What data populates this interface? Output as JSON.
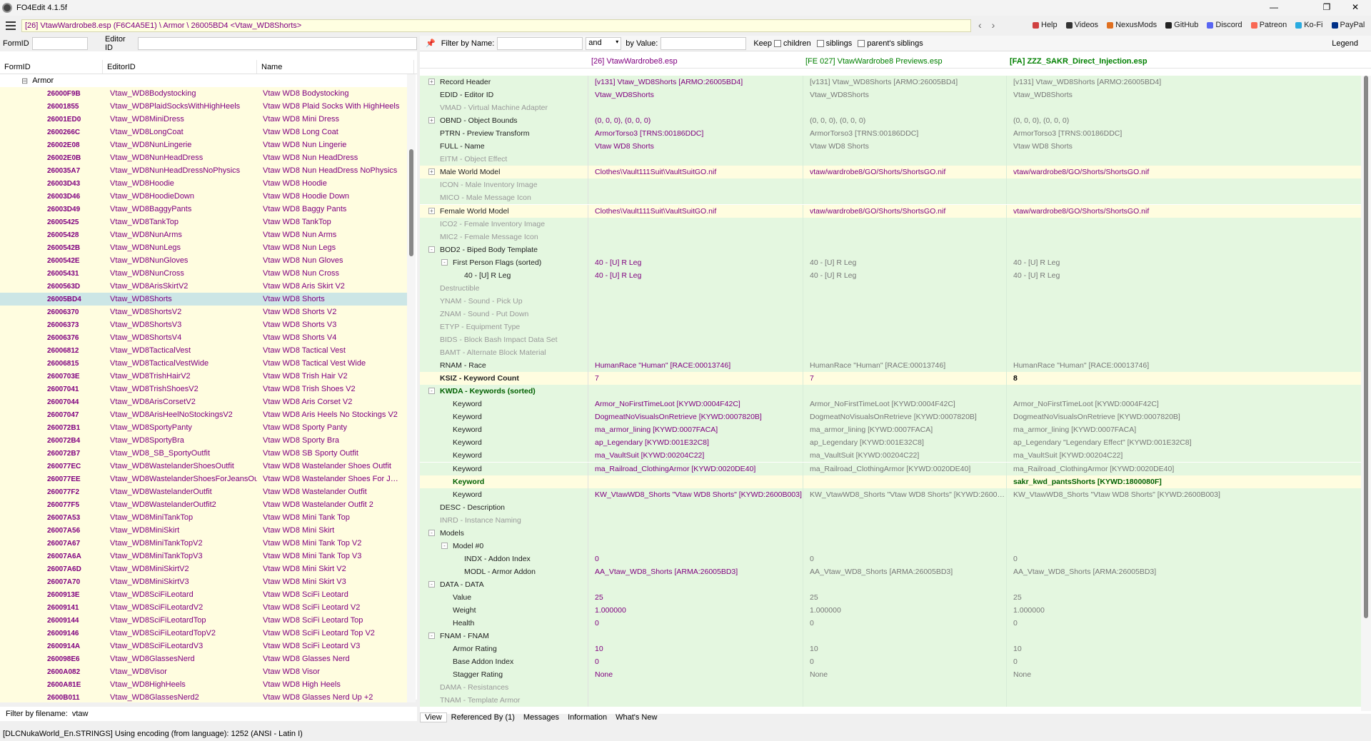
{
  "window": {
    "title": "FO4Edit 4.1.5f"
  },
  "toolbar": {
    "path": "[26] VtawWardrobe8.esp (F6C4A5E1) \\ Armor \\ 26005BD4 <Vtaw_WD8Shorts>",
    "links": [
      {
        "label": "Help",
        "color": "#d04040"
      },
      {
        "label": "Videos",
        "color": "#333"
      },
      {
        "label": "NexusMods",
        "color": "#e07020"
      },
      {
        "label": "GitHub",
        "color": "#222"
      },
      {
        "label": "Discord",
        "color": "#5865f2"
      },
      {
        "label": "Patreon",
        "color": "#f96854"
      },
      {
        "label": "Ko-Fi",
        "color": "#29abe0"
      },
      {
        "label": "PayPal",
        "color": "#003087"
      }
    ]
  },
  "left": {
    "formid_label": "FormID",
    "editorid_label": "Editor ID",
    "columns": [
      "FormID",
      "EditorID",
      "Name"
    ],
    "group": "Armor",
    "rows": [
      [
        "26000F9B",
        "Vtaw_WD8Bodystocking",
        "Vtaw WD8 Bodystocking"
      ],
      [
        "26001855",
        "Vtaw_WD8PlaidSocksWithHighHeels",
        "Vtaw WD8 Plaid Socks With HighHeels"
      ],
      [
        "26001ED0",
        "Vtaw_WD8MiniDress",
        "Vtaw WD8 Mini Dress"
      ],
      [
        "2600266C",
        "Vtaw_WD8LongCoat",
        "Vtaw WD8 Long Coat"
      ],
      [
        "26002E08",
        "Vtaw_WD8NunLingerie",
        "Vtaw WD8 Nun Lingerie"
      ],
      [
        "26002E0B",
        "Vtaw_WD8NunHeadDress",
        "Vtaw WD8 Nun HeadDress"
      ],
      [
        "260035A7",
        "Vtaw_WD8NunHeadDressNoPhysics",
        "Vtaw WD8 Nun HeadDress NoPhysics"
      ],
      [
        "26003D43",
        "Vtaw_WD8Hoodie",
        "Vtaw WD8 Hoodie"
      ],
      [
        "26003D46",
        "Vtaw_WD8HoodieDown",
        "Vtaw WD8 Hoodie Down"
      ],
      [
        "26003D49",
        "Vtaw_WD8BaggyPants",
        "Vtaw WD8 Baggy Pants"
      ],
      [
        "26005425",
        "Vtaw_WD8TankTop",
        "Vtaw WD8 TankTop"
      ],
      [
        "26005428",
        "Vtaw_WD8NunArms",
        "Vtaw WD8 Nun Arms"
      ],
      [
        "2600542B",
        "Vtaw_WD8NunLegs",
        "Vtaw WD8 Nun Legs"
      ],
      [
        "2600542E",
        "Vtaw_WD8NunGloves",
        "Vtaw WD8 Nun Gloves"
      ],
      [
        "26005431",
        "Vtaw_WD8NunCross",
        "Vtaw WD8 Nun Cross"
      ],
      [
        "2600563D",
        "Vtaw_WD8ArisSkirtV2",
        "Vtaw WD8 Aris Skirt V2"
      ],
      [
        "26005BD4",
        "Vtaw_WD8Shorts",
        "Vtaw WD8 Shorts"
      ],
      [
        "26006370",
        "Vtaw_WD8ShortsV2",
        "Vtaw WD8 Shorts V2"
      ],
      [
        "26006373",
        "Vtaw_WD8ShortsV3",
        "Vtaw WD8 Shorts V3"
      ],
      [
        "26006376",
        "Vtaw_WD8ShortsV4",
        "Vtaw WD8 Shorts V4"
      ],
      [
        "26006812",
        "Vtaw_WD8TacticalVest",
        "Vtaw WD8 Tactical Vest"
      ],
      [
        "26006815",
        "Vtaw_WD8TacticalVestWide",
        "Vtaw WD8 Tactical Vest Wide"
      ],
      [
        "2600703E",
        "Vtaw_WD8TrishHairV2",
        "Vtaw WD8 Trish Hair V2"
      ],
      [
        "26007041",
        "Vtaw_WD8TrishShoesV2",
        "Vtaw WD8 Trish Shoes V2"
      ],
      [
        "26007044",
        "Vtaw_WD8ArisCorsetV2",
        "Vtaw WD8 Aris Corset V2"
      ],
      [
        "26007047",
        "Vtaw_WD8ArisHeelNoStockingsV2",
        "Vtaw WD8 Aris Heels No Stockings V2"
      ],
      [
        "260072B1",
        "Vtaw_WD8SportyPanty",
        "Vtaw WD8 Sporty Panty"
      ],
      [
        "260072B4",
        "Vtaw_WD8SportyBra",
        "Vtaw WD8 Sporty Bra"
      ],
      [
        "260072B7",
        "Vtaw_WD8_SB_SportyOutfit",
        "Vtaw WD8 SB Sporty Outfit"
      ],
      [
        "260077EC",
        "Vtaw_WD8WastelanderShoesOutfit",
        "Vtaw WD8 Wastelander Shoes Outfit"
      ],
      [
        "260077EE",
        "Vtaw_WD8WastelanderShoesForJeansOu...",
        "Vtaw WD8 Wastelander Shoes For Jeans..."
      ],
      [
        "260077F2",
        "Vtaw_WD8WastelanderOutfit",
        "Vtaw WD8 Wastelander Outfit"
      ],
      [
        "260077F5",
        "Vtaw_WD8WastelanderOutfit2",
        "Vtaw WD8 Wastelander Outfit 2"
      ],
      [
        "26007A53",
        "Vtaw_WD8MiniTankTop",
        "Vtaw WD8 Mini Tank Top"
      ],
      [
        "26007A56",
        "Vtaw_WD8MiniSkirt",
        "Vtaw WD8 Mini Skirt"
      ],
      [
        "26007A67",
        "Vtaw_WD8MiniTankTopV2",
        "Vtaw WD8 Mini Tank Top V2"
      ],
      [
        "26007A6A",
        "Vtaw_WD8MiniTankTopV3",
        "Vtaw WD8 Mini Tank Top V3"
      ],
      [
        "26007A6D",
        "Vtaw_WD8MiniSkirtV2",
        "Vtaw WD8 Mini Skirt V2"
      ],
      [
        "26007A70",
        "Vtaw_WD8MiniSkirtV3",
        "Vtaw WD8 Mini Skirt V3"
      ],
      [
        "2600913E",
        "Vtaw_WD8SciFiLeotard",
        "Vtaw WD8 SciFi Leotard"
      ],
      [
        "26009141",
        "Vtaw_WD8SciFiLeotardV2",
        "Vtaw WD8 SciFi Leotard V2"
      ],
      [
        "26009144",
        "Vtaw_WD8SciFiLeotardTop",
        "Vtaw WD8 SciFi Leotard Top"
      ],
      [
        "26009146",
        "Vtaw_WD8SciFiLeotardTopV2",
        "Vtaw WD8 SciFi Leotard Top V2"
      ],
      [
        "2600914A",
        "Vtaw_WD8SciFiLeotardV3",
        "Vtaw WD8 SciFi Leotard V3"
      ],
      [
        "260098E6",
        "Vtaw_WD8GlassesNerd",
        "Vtaw WD8 Glasses Nerd"
      ],
      [
        "2600A082",
        "Vtaw_WD8Visor",
        "Vtaw WD8 Visor"
      ],
      [
        "2600A81E",
        "Vtaw_WD8HighHeels",
        "Vtaw WD8 High Heels"
      ],
      [
        "2600B011",
        "Vtaw_WD8GlassesNerd2",
        "Vtaw WD8 Glasses Nerd  Up +2"
      ]
    ],
    "selected_index": 16,
    "filename_filter_label": "Filter by filename:",
    "filename_filter_value": "vtaw"
  },
  "right": {
    "filter": {
      "name_label": "Filter by Name:",
      "op": "and",
      "value_label": "by Value:",
      "keep": "Keep",
      "children": "children",
      "siblings": "siblings",
      "parents": "parent's siblings",
      "legend": "Legend"
    },
    "files": [
      "[26] VtawWardrobe8.esp",
      "[FE 027] VtawWardrobe8 Previews.esp",
      "[FA] ZZZ_SAKR_Direct_Injection.esp"
    ],
    "rows": [
      {
        "l": "Record Header",
        "i": 0,
        "e": "+",
        "v": [
          "[v131] Vtaw_WD8Shorts [ARMO:26005BD4]",
          "[v131] Vtaw_WD8Shorts [ARMO:26005BD4]",
          "[v131] Vtaw_WD8Shorts [ARMO:26005BD4]"
        ],
        "bg": "g"
      },
      {
        "l": "EDID - Editor ID",
        "i": 0,
        "v": [
          "Vtaw_WD8Shorts",
          "Vtaw_WD8Shorts",
          "Vtaw_WD8Shorts"
        ],
        "bg": "g"
      },
      {
        "l": "VMAD - Virtual Machine Adapter",
        "i": 0,
        "v": [
          "",
          "",
          ""
        ],
        "bg": "g",
        "dim": true
      },
      {
        "l": "OBND - Object Bounds",
        "i": 0,
        "e": "+",
        "v": [
          "(0, 0, 0), (0, 0, 0)",
          "(0, 0, 0), (0, 0, 0)",
          "(0, 0, 0), (0, 0, 0)"
        ],
        "bg": "g"
      },
      {
        "l": "PTRN - Preview Transform",
        "i": 0,
        "v": [
          "ArmorTorso3 [TRNS:00186DDC]",
          "ArmorTorso3 [TRNS:00186DDC]",
          "ArmorTorso3 [TRNS:00186DDC]"
        ],
        "bg": "g"
      },
      {
        "l": "FULL - Name",
        "i": 0,
        "v": [
          "Vtaw WD8 Shorts",
          "Vtaw WD8 Shorts",
          "Vtaw WD8 Shorts"
        ],
        "bg": "g"
      },
      {
        "l": "EITM - Object Effect",
        "i": 0,
        "v": [
          "",
          "",
          ""
        ],
        "bg": "g",
        "dim": true
      },
      {
        "l": "Male World Model",
        "i": 0,
        "e": "+",
        "v": [
          "Clothes\\Vault111Suit\\VaultSuitGO.nif",
          "vtaw/wardrobe8/GO/Shorts/ShortsGO.nif",
          "vtaw/wardrobe8/GO/Shorts/ShortsGO.nif"
        ],
        "bg": "y"
      },
      {
        "l": "ICON - Male Inventory Image",
        "i": 0,
        "v": [
          "",
          "",
          ""
        ],
        "bg": "g",
        "dim": true
      },
      {
        "l": "MICO - Male Message Icon",
        "i": 0,
        "v": [
          "",
          "",
          ""
        ],
        "bg": "g",
        "dim": true
      },
      {
        "l": "Female World Model",
        "i": 0,
        "e": "+",
        "v": [
          "Clothes\\Vault111Suit\\VaultSuitGO.nif",
          "vtaw/wardrobe8/GO/Shorts/ShortsGO.nif",
          "vtaw/wardrobe8/GO/Shorts/ShortsGO.nif"
        ],
        "bg": "y"
      },
      {
        "l": "ICO2 - Female Inventory Image",
        "i": 0,
        "v": [
          "",
          "",
          ""
        ],
        "bg": "g",
        "dim": true
      },
      {
        "l": "MIC2 - Female Message Icon",
        "i": 0,
        "v": [
          "",
          "",
          ""
        ],
        "bg": "g",
        "dim": true
      },
      {
        "l": "BOD2 - Biped Body Template",
        "i": 0,
        "e": "-",
        "v": [
          "",
          "",
          ""
        ],
        "bg": "g"
      },
      {
        "l": "First Person Flags (sorted)",
        "i": 1,
        "e": "-",
        "v": [
          "40 - [U] R Leg",
          "40 - [U] R Leg",
          "40 - [U] R Leg"
        ],
        "bg": "g"
      },
      {
        "l": "40 - [U] R Leg",
        "i": 2,
        "v": [
          "40 - [U] R Leg",
          "40 - [U] R Leg",
          "40 - [U] R Leg"
        ],
        "bg": "g"
      },
      {
        "l": "Destructible",
        "i": 0,
        "v": [
          "",
          "",
          ""
        ],
        "bg": "g",
        "dim": true
      },
      {
        "l": "YNAM - Sound - Pick Up",
        "i": 0,
        "v": [
          "",
          "",
          ""
        ],
        "bg": "g",
        "dim": true
      },
      {
        "l": "ZNAM - Sound - Put Down",
        "i": 0,
        "v": [
          "",
          "",
          ""
        ],
        "bg": "g",
        "dim": true
      },
      {
        "l": "ETYP - Equipment Type",
        "i": 0,
        "v": [
          "",
          "",
          ""
        ],
        "bg": "g",
        "dim": true
      },
      {
        "l": "BIDS - Block Bash Impact Data Set",
        "i": 0,
        "v": [
          "",
          "",
          ""
        ],
        "bg": "g",
        "dim": true
      },
      {
        "l": "BAMT - Alternate Block Material",
        "i": 0,
        "v": [
          "",
          "",
          ""
        ],
        "bg": "g",
        "dim": true
      },
      {
        "l": "RNAM - Race",
        "i": 0,
        "v": [
          "HumanRace \"Human\" [RACE:00013746]",
          "HumanRace \"Human\" [RACE:00013746]",
          "HumanRace \"Human\" [RACE:00013746]"
        ],
        "bg": "g"
      },
      {
        "l": "KSIZ - Keyword Count",
        "i": 0,
        "v": [
          "7",
          "7",
          "8"
        ],
        "bg": "y",
        "bold": true
      },
      {
        "l": "KWDA - Keywords (sorted)",
        "i": 0,
        "e": "-",
        "v": [
          "",
          "",
          ""
        ],
        "bg": "g",
        "green": true
      },
      {
        "l": "Keyword",
        "i": 1,
        "v": [
          "Armor_NoFirstTimeLoot [KYWD:0004F42C]",
          "Armor_NoFirstTimeLoot [KYWD:0004F42C]",
          "Armor_NoFirstTimeLoot [KYWD:0004F42C]"
        ],
        "bg": "g"
      },
      {
        "l": "Keyword",
        "i": 1,
        "v": [
          "DogmeatNoVisualsOnRetrieve [KYWD:0007820B]",
          "DogmeatNoVisualsOnRetrieve [KYWD:0007820B]",
          "DogmeatNoVisualsOnRetrieve [KYWD:0007820B]"
        ],
        "bg": "g"
      },
      {
        "l": "Keyword",
        "i": 1,
        "v": [
          "ma_armor_lining [KYWD:0007FACA]",
          "ma_armor_lining [KYWD:0007FACA]",
          "ma_armor_lining [KYWD:0007FACA]"
        ],
        "bg": "g"
      },
      {
        "l": "Keyword",
        "i": 1,
        "v": [
          "ap_Legendary [KYWD:001E32C8]",
          "ap_Legendary [KYWD:001E32C8]",
          "ap_Legendary \"Legendary Effect\" [KYWD:001E32C8]"
        ],
        "bg": "g"
      },
      {
        "l": "Keyword",
        "i": 1,
        "v": [
          "ma_VaultSuit [KYWD:00204C22]",
          "ma_VaultSuit [KYWD:00204C22]",
          "ma_VaultSuit [KYWD:00204C22]"
        ],
        "bg": "g"
      },
      {
        "l": "Keyword",
        "i": 1,
        "v": [
          "ma_Railroad_ClothingArmor [KYWD:0020DE40]",
          "ma_Railroad_ClothingArmor [KYWD:0020DE40]",
          "ma_Railroad_ClothingArmor [KYWD:0020DE40]"
        ],
        "bg": "g"
      },
      {
        "l": "Keyword",
        "i": 1,
        "v": [
          "",
          "",
          "sakr_kwd_pantsShorts [KYWD:1800080F]"
        ],
        "bg": "y",
        "green": true
      },
      {
        "l": "Keyword",
        "i": 1,
        "v": [
          "KW_VtawWD8_Shorts \"Vtaw WD8 Shorts\" [KYWD:2600B003]",
          "KW_VtawWD8_Shorts \"Vtaw WD8 Shorts\" [KYWD:2600B...",
          "KW_VtawWD8_Shorts \"Vtaw WD8 Shorts\" [KYWD:2600B003]"
        ],
        "bg": "g"
      },
      {
        "l": "DESC - Description",
        "i": 0,
        "v": [
          "",
          "",
          ""
        ],
        "bg": "g"
      },
      {
        "l": "INRD - Instance Naming",
        "i": 0,
        "v": [
          "",
          "",
          ""
        ],
        "bg": "g",
        "dim": true
      },
      {
        "l": "Models",
        "i": 0,
        "e": "-",
        "v": [
          "",
          "",
          ""
        ],
        "bg": "g"
      },
      {
        "l": "Model #0",
        "i": 1,
        "e": "-",
        "v": [
          "",
          "",
          ""
        ],
        "bg": "g"
      },
      {
        "l": "INDX - Addon Index",
        "i": 2,
        "v": [
          "0",
          "0",
          "0"
        ],
        "bg": "g"
      },
      {
        "l": "MODL - Armor Addon",
        "i": 2,
        "v": [
          "AA_Vtaw_WD8_Shorts [ARMA:26005BD3]",
          "AA_Vtaw_WD8_Shorts [ARMA:26005BD3]",
          "AA_Vtaw_WD8_Shorts [ARMA:26005BD3]"
        ],
        "bg": "g"
      },
      {
        "l": "DATA - DATA",
        "i": 0,
        "e": "-",
        "v": [
          "",
          "",
          ""
        ],
        "bg": "g"
      },
      {
        "l": "Value",
        "i": 1,
        "v": [
          "25",
          "25",
          "25"
        ],
        "bg": "g"
      },
      {
        "l": "Weight",
        "i": 1,
        "v": [
          "1.000000",
          "1.000000",
          "1.000000"
        ],
        "bg": "g"
      },
      {
        "l": "Health",
        "i": 1,
        "v": [
          "0",
          "0",
          "0"
        ],
        "bg": "g"
      },
      {
        "l": "FNAM - FNAM",
        "i": 0,
        "e": "-",
        "v": [
          "",
          "",
          ""
        ],
        "bg": "g"
      },
      {
        "l": "Armor Rating",
        "i": 1,
        "v": [
          "10",
          "10",
          "10"
        ],
        "bg": "g"
      },
      {
        "l": "Base Addon Index",
        "i": 1,
        "v": [
          "0",
          "0",
          "0"
        ],
        "bg": "g"
      },
      {
        "l": "Stagger Rating",
        "i": 1,
        "v": [
          "None",
          "None",
          "None"
        ],
        "bg": "g"
      },
      {
        "l": "DAMA - Resistances",
        "i": 0,
        "v": [
          "",
          "",
          ""
        ],
        "bg": "g",
        "dim": true
      },
      {
        "l": "TNAM - Template Armor",
        "i": 0,
        "v": [
          "",
          "",
          ""
        ],
        "bg": "g",
        "dim": true
      }
    ],
    "tabs": [
      "View",
      "Referenced By (1)",
      "Messages",
      "Information",
      "What's New"
    ]
  },
  "status": "[DLCNukaWorld_En.STRINGS] Using encoding (from language): 1252  (ANSI - Latin I)",
  "colors": {
    "green": "#e4f7e0",
    "yellow": "#fffde0",
    "purple": "#800080",
    "conflict_green": "#008000"
  }
}
